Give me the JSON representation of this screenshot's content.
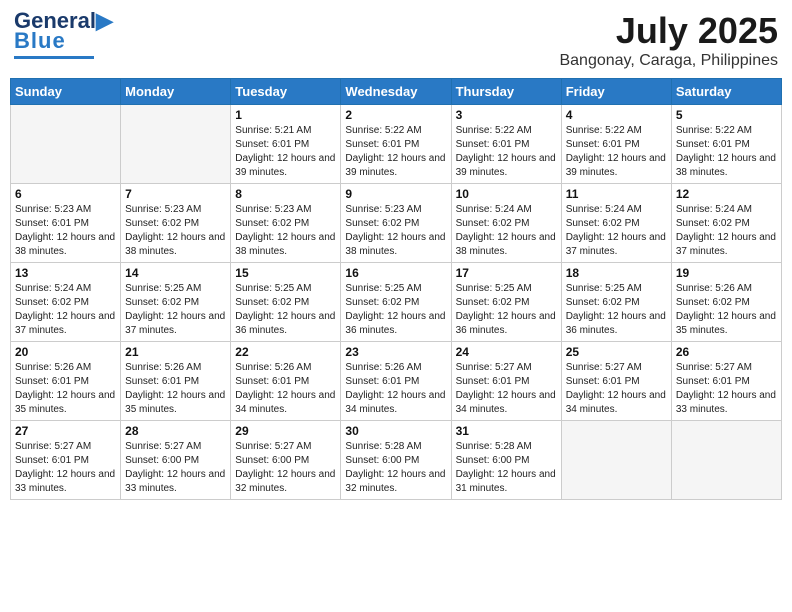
{
  "header": {
    "logo_line1": "General",
    "logo_line2": "Blue",
    "month_year": "July 2025",
    "location": "Bangonay, Caraga, Philippines"
  },
  "weekdays": [
    "Sunday",
    "Monday",
    "Tuesday",
    "Wednesday",
    "Thursday",
    "Friday",
    "Saturday"
  ],
  "weeks": [
    [
      {
        "day": "",
        "info": ""
      },
      {
        "day": "",
        "info": ""
      },
      {
        "day": "1",
        "info": "Sunrise: 5:21 AM\nSunset: 6:01 PM\nDaylight: 12 hours and 39 minutes."
      },
      {
        "day": "2",
        "info": "Sunrise: 5:22 AM\nSunset: 6:01 PM\nDaylight: 12 hours and 39 minutes."
      },
      {
        "day": "3",
        "info": "Sunrise: 5:22 AM\nSunset: 6:01 PM\nDaylight: 12 hours and 39 minutes."
      },
      {
        "day": "4",
        "info": "Sunrise: 5:22 AM\nSunset: 6:01 PM\nDaylight: 12 hours and 39 minutes."
      },
      {
        "day": "5",
        "info": "Sunrise: 5:22 AM\nSunset: 6:01 PM\nDaylight: 12 hours and 38 minutes."
      }
    ],
    [
      {
        "day": "6",
        "info": "Sunrise: 5:23 AM\nSunset: 6:01 PM\nDaylight: 12 hours and 38 minutes."
      },
      {
        "day": "7",
        "info": "Sunrise: 5:23 AM\nSunset: 6:02 PM\nDaylight: 12 hours and 38 minutes."
      },
      {
        "day": "8",
        "info": "Sunrise: 5:23 AM\nSunset: 6:02 PM\nDaylight: 12 hours and 38 minutes."
      },
      {
        "day": "9",
        "info": "Sunrise: 5:23 AM\nSunset: 6:02 PM\nDaylight: 12 hours and 38 minutes."
      },
      {
        "day": "10",
        "info": "Sunrise: 5:24 AM\nSunset: 6:02 PM\nDaylight: 12 hours and 38 minutes."
      },
      {
        "day": "11",
        "info": "Sunrise: 5:24 AM\nSunset: 6:02 PM\nDaylight: 12 hours and 37 minutes."
      },
      {
        "day": "12",
        "info": "Sunrise: 5:24 AM\nSunset: 6:02 PM\nDaylight: 12 hours and 37 minutes."
      }
    ],
    [
      {
        "day": "13",
        "info": "Sunrise: 5:24 AM\nSunset: 6:02 PM\nDaylight: 12 hours and 37 minutes."
      },
      {
        "day": "14",
        "info": "Sunrise: 5:25 AM\nSunset: 6:02 PM\nDaylight: 12 hours and 37 minutes."
      },
      {
        "day": "15",
        "info": "Sunrise: 5:25 AM\nSunset: 6:02 PM\nDaylight: 12 hours and 36 minutes."
      },
      {
        "day": "16",
        "info": "Sunrise: 5:25 AM\nSunset: 6:02 PM\nDaylight: 12 hours and 36 minutes."
      },
      {
        "day": "17",
        "info": "Sunrise: 5:25 AM\nSunset: 6:02 PM\nDaylight: 12 hours and 36 minutes."
      },
      {
        "day": "18",
        "info": "Sunrise: 5:25 AM\nSunset: 6:02 PM\nDaylight: 12 hours and 36 minutes."
      },
      {
        "day": "19",
        "info": "Sunrise: 5:26 AM\nSunset: 6:02 PM\nDaylight: 12 hours and 35 minutes."
      }
    ],
    [
      {
        "day": "20",
        "info": "Sunrise: 5:26 AM\nSunset: 6:01 PM\nDaylight: 12 hours and 35 minutes."
      },
      {
        "day": "21",
        "info": "Sunrise: 5:26 AM\nSunset: 6:01 PM\nDaylight: 12 hours and 35 minutes."
      },
      {
        "day": "22",
        "info": "Sunrise: 5:26 AM\nSunset: 6:01 PM\nDaylight: 12 hours and 34 minutes."
      },
      {
        "day": "23",
        "info": "Sunrise: 5:26 AM\nSunset: 6:01 PM\nDaylight: 12 hours and 34 minutes."
      },
      {
        "day": "24",
        "info": "Sunrise: 5:27 AM\nSunset: 6:01 PM\nDaylight: 12 hours and 34 minutes."
      },
      {
        "day": "25",
        "info": "Sunrise: 5:27 AM\nSunset: 6:01 PM\nDaylight: 12 hours and 34 minutes."
      },
      {
        "day": "26",
        "info": "Sunrise: 5:27 AM\nSunset: 6:01 PM\nDaylight: 12 hours and 33 minutes."
      }
    ],
    [
      {
        "day": "27",
        "info": "Sunrise: 5:27 AM\nSunset: 6:01 PM\nDaylight: 12 hours and 33 minutes."
      },
      {
        "day": "28",
        "info": "Sunrise: 5:27 AM\nSunset: 6:00 PM\nDaylight: 12 hours and 33 minutes."
      },
      {
        "day": "29",
        "info": "Sunrise: 5:27 AM\nSunset: 6:00 PM\nDaylight: 12 hours and 32 minutes."
      },
      {
        "day": "30",
        "info": "Sunrise: 5:28 AM\nSunset: 6:00 PM\nDaylight: 12 hours and 32 minutes."
      },
      {
        "day": "31",
        "info": "Sunrise: 5:28 AM\nSunset: 6:00 PM\nDaylight: 12 hours and 31 minutes."
      },
      {
        "day": "",
        "info": ""
      },
      {
        "day": "",
        "info": ""
      }
    ]
  ]
}
